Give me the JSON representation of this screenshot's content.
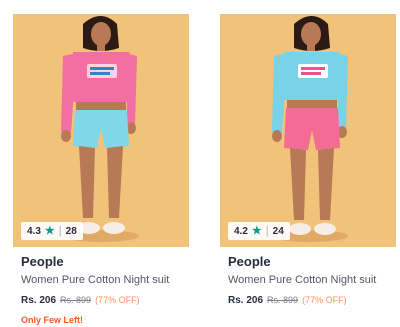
{
  "products": [
    {
      "rating": "4.3",
      "rating_count": "28",
      "brand": "People",
      "title": "Women Pure Cotton Night suit",
      "price": "Rs. 206",
      "mrp": "Rs. 899",
      "discount": "(77% OFF)",
      "stock_note": "Only Few Left!",
      "colors": {
        "background": "#f1c27a",
        "top": "#f26ea3",
        "bottom": "#7fd7e8"
      }
    },
    {
      "rating": "4.2",
      "rating_count": "24",
      "brand": "People",
      "title": "Women Pure Cotton Night suit",
      "price": "Rs. 206",
      "mrp": "Rs. 899",
      "discount": "(77% OFF)",
      "stock_note": "",
      "colors": {
        "background": "#f1c27a",
        "top": "#79d3e8",
        "bottom": "#f46c95"
      }
    }
  ],
  "icons": {
    "rating_star": "star-icon"
  },
  "accent_colors": {
    "rating_star": "#14958f",
    "discount": "#ff905a",
    "stock_note": "#ff5722"
  }
}
